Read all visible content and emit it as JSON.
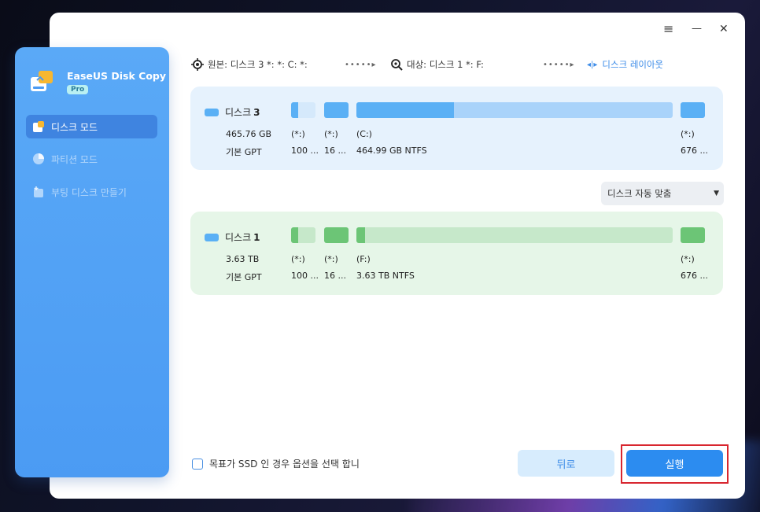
{
  "app": {
    "name": "EaseUS Disk Copy",
    "badge": "Pro"
  },
  "window_controls": {
    "menu": "≡",
    "minimize": "—",
    "close": "✕"
  },
  "sidebar": {
    "items": [
      {
        "label": "디스크 모드",
        "active": true
      },
      {
        "label": "파티션 모드",
        "active": false
      },
      {
        "label": "부팅 디스크 만들기",
        "active": false
      }
    ]
  },
  "path": {
    "source": "원본: 디스크 3 *: *: C: *:",
    "target": "대상: 디스크 1 *: F:",
    "layout_link": "디스크 레이아웃",
    "dots": "•••••"
  },
  "source_disk": {
    "title_prefix": "디스크",
    "number": "3",
    "size": "465.76 GB",
    "type": "기본 GPT",
    "partitions": [
      {
        "label": "(*:)",
        "detail": "100 ..."
      },
      {
        "label": "(*:)",
        "detail": "16 ..."
      },
      {
        "label": "(C:)",
        "detail": "464.99 GB NTFS",
        "used_fraction": 0.31
      },
      {
        "label": "(*:)",
        "detail": "676 ..."
      }
    ],
    "color": "#5ab0f5"
  },
  "target_disk": {
    "title_prefix": "디스크",
    "number": "1",
    "size": "3.63 TB",
    "type": "기본 GPT",
    "partitions": [
      {
        "label": "(*:)",
        "detail": "100 ..."
      },
      {
        "label": "(*:)",
        "detail": "16 ..."
      },
      {
        "label": "(F:)",
        "detail": "3.63 TB NTFS",
        "used_fraction": 0.03
      },
      {
        "label": "(*:)",
        "detail": "676 ..."
      }
    ],
    "color": "#6cc576"
  },
  "fit_dropdown": {
    "value": "디스크 자동 맞춤"
  },
  "ssd_option": {
    "label": "목표가 SSD 인 경우 옵션을 선택 합니",
    "checked": false
  },
  "buttons": {
    "back": "뒤로",
    "run": "실행"
  }
}
